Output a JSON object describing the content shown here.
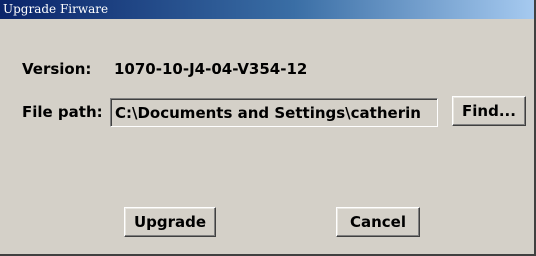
{
  "window": {
    "title": "Upgrade Firware"
  },
  "version": {
    "label": "Version:",
    "value": "1070-10-J4-04-V354-12"
  },
  "file_path": {
    "label": "File path:",
    "value": "C:\\Documents and Settings\\catherin"
  },
  "buttons": {
    "find": "Find...",
    "upgrade": "Upgrade",
    "cancel": "Cancel"
  },
  "colors": {
    "face": "#d4d0c8",
    "title_start": "#0a246a",
    "title_end": "#a6caf0"
  }
}
